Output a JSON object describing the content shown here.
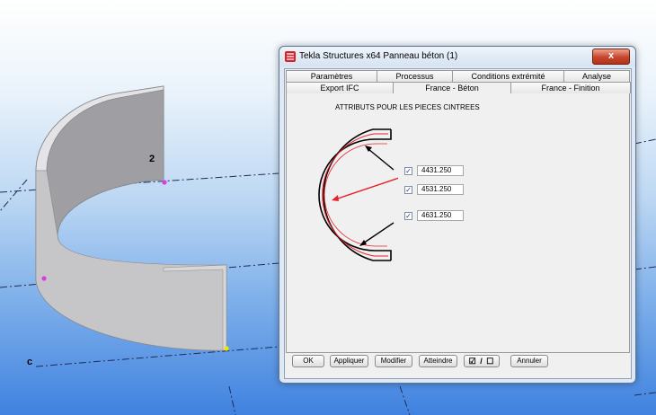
{
  "viewport": {
    "grid_labels": [
      "2",
      "c"
    ],
    "colors": {
      "wall": "#c9c9cc",
      "gridline": "#1d2c55",
      "point_magenta": "#e03be0",
      "point_yellow": "#e8e800"
    }
  },
  "dialog": {
    "title": "Tekla Structures x64  Panneau béton (1)",
    "close_label": "x",
    "tabs_row1": [
      {
        "label": "Paramètres",
        "active": false
      },
      {
        "label": "Processus",
        "active": false
      },
      {
        "label": "Conditions extrémité",
        "active": false
      },
      {
        "label": "Analyse",
        "active": false
      }
    ],
    "tabs_row2": [
      {
        "label": "Export IFC",
        "active": false
      },
      {
        "label": "France - Béton",
        "active": true
      },
      {
        "label": "France - Finition",
        "active": false
      }
    ],
    "section_title": "ATTRIBUTS POUR LES PIECES CINTREES",
    "attributes": [
      {
        "checked": true,
        "value": "4431.250"
      },
      {
        "checked": true,
        "value": "4531.250"
      },
      {
        "checked": true,
        "value": "4631.250"
      }
    ],
    "buttons": {
      "ok": "OK",
      "apply": "Appliquer",
      "modify": "Modifier",
      "get": "Atteindre",
      "toggle": "☑ / ☐",
      "cancel": "Annuler"
    }
  }
}
